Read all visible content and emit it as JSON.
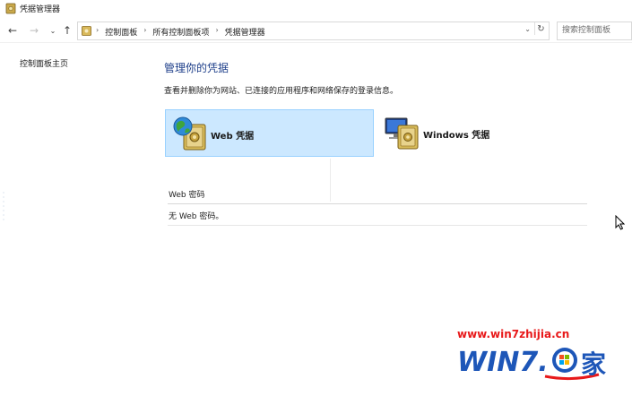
{
  "window": {
    "title": "凭据管理器"
  },
  "nav": {
    "back_glyph": "←",
    "forward_glyph": "→",
    "recent_glyph": "⌄",
    "up_glyph": "↑",
    "refresh_glyph": "↻",
    "dropdown_glyph": "⌄",
    "breadcrumb": [
      "控制面板",
      "所有控制面板项",
      "凭据管理器"
    ],
    "separator": "›",
    "search_placeholder": "搜索控制面板"
  },
  "sidebar": {
    "home_link": "控制面板主页"
  },
  "main": {
    "heading": "管理你的凭据",
    "description": "查看并删除你为网站、已连接的应用程序和网络保存的登录信息。",
    "tiles": [
      {
        "label": "Web 凭据",
        "selected": true,
        "icon": "globe-vault-icon"
      },
      {
        "label": "Windows 凭据",
        "selected": false,
        "icon": "monitor-vault-icon"
      }
    ],
    "section_title": "Web 密码",
    "empty_message": "无 Web 密码。"
  },
  "watermark": {
    "url": "www.win7zhijia.cn",
    "logo_text": "WIN7.",
    "logo_char": "家"
  },
  "colors": {
    "heading": "#1e3f8a",
    "tile_selected_bg": "#cce8ff",
    "tile_selected_border": "#99d1ff",
    "watermark_red": "#e8191a",
    "watermark_blue": "#1d56b8"
  }
}
